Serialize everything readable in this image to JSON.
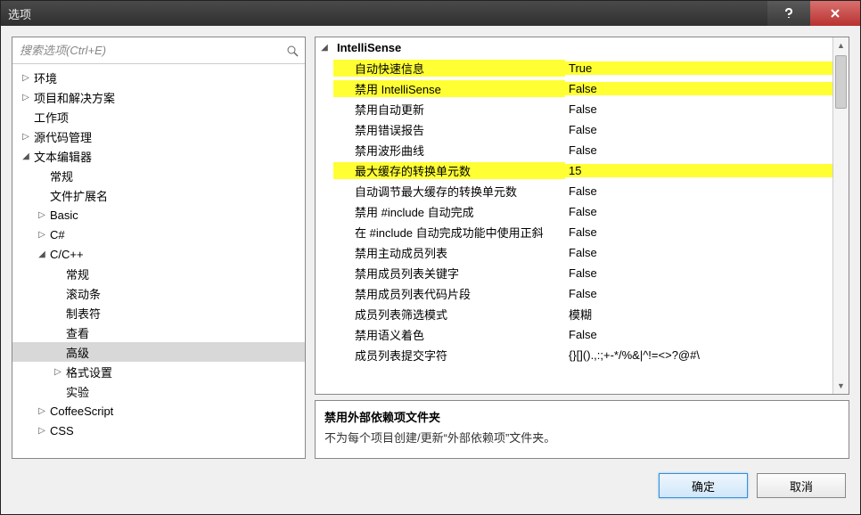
{
  "window": {
    "title": "选项"
  },
  "search": {
    "placeholder": "搜索选项(Ctrl+E)"
  },
  "tree": [
    {
      "label": "环境",
      "level": 0,
      "tw": "▷",
      "sel": false
    },
    {
      "label": "项目和解决方案",
      "level": 0,
      "tw": "▷",
      "sel": false
    },
    {
      "label": "工作项",
      "level": 0,
      "tw": "",
      "sel": false
    },
    {
      "label": "源代码管理",
      "level": 0,
      "tw": "▷",
      "sel": false
    },
    {
      "label": "文本编辑器",
      "level": 0,
      "tw": "◢",
      "sel": false
    },
    {
      "label": "常规",
      "level": 1,
      "tw": "",
      "sel": false
    },
    {
      "label": "文件扩展名",
      "level": 1,
      "tw": "",
      "sel": false
    },
    {
      "label": "Basic",
      "level": 1,
      "tw": "▷",
      "sel": false
    },
    {
      "label": "C#",
      "level": 1,
      "tw": "▷",
      "sel": false
    },
    {
      "label": "C/C++",
      "level": 1,
      "tw": "◢",
      "sel": false
    },
    {
      "label": "常规",
      "level": 2,
      "tw": "",
      "sel": false
    },
    {
      "label": "滚动条",
      "level": 2,
      "tw": "",
      "sel": false
    },
    {
      "label": "制表符",
      "level": 2,
      "tw": "",
      "sel": false
    },
    {
      "label": "查看",
      "level": 2,
      "tw": "",
      "sel": false
    },
    {
      "label": "高级",
      "level": 2,
      "tw": "",
      "sel": true
    },
    {
      "label": "格式设置",
      "level": 2,
      "tw": "▷",
      "sel": false
    },
    {
      "label": "实验",
      "level": 2,
      "tw": "",
      "sel": false
    },
    {
      "label": "CoffeeScript",
      "level": 1,
      "tw": "▷",
      "sel": false
    },
    {
      "label": "CSS",
      "level": 1,
      "tw": "▷",
      "sel": false
    }
  ],
  "props": {
    "section": "IntelliSense",
    "rows": [
      {
        "name": "自动快速信息",
        "value": "True",
        "hl": true
      },
      {
        "name": "禁用 IntelliSense",
        "value": "False",
        "hl": true
      },
      {
        "name": "禁用自动更新",
        "value": "False",
        "hl": false
      },
      {
        "name": "禁用错误报告",
        "value": "False",
        "hl": false
      },
      {
        "name": "禁用波形曲线",
        "value": "False",
        "hl": false
      },
      {
        "name": "最大缓存的转换单元数",
        "value": "15",
        "hl": true
      },
      {
        "name": "自动调节最大缓存的转换单元数",
        "value": "False",
        "hl": false
      },
      {
        "name": "禁用 #include 自动完成",
        "value": "False",
        "hl": false
      },
      {
        "name": "在 #include 自动完成功能中使用正斜",
        "value": "False",
        "hl": false
      },
      {
        "name": "禁用主动成员列表",
        "value": "False",
        "hl": false
      },
      {
        "name": "禁用成员列表关键字",
        "value": "False",
        "hl": false
      },
      {
        "name": "禁用成员列表代码片段",
        "value": "False",
        "hl": false
      },
      {
        "name": "成员列表筛选模式",
        "value": "模糊",
        "hl": false
      },
      {
        "name": "禁用语义着色",
        "value": "False",
        "hl": false
      },
      {
        "name": "成员列表提交字符",
        "value": "{}[]().,:;+-*/%&|^!=<>?@#\\",
        "hl": false
      }
    ]
  },
  "desc": {
    "title": "禁用外部依赖项文件夹",
    "body": "不为每个项目创建/更新“外部依赖项”文件夹。"
  },
  "buttons": {
    "ok": "确定",
    "cancel": "取消"
  }
}
